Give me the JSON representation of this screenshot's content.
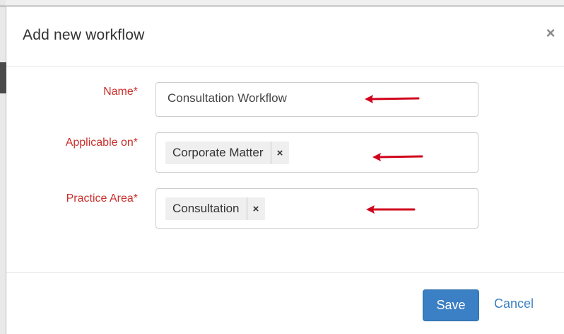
{
  "modal": {
    "title": "Add new workflow",
    "close_symbol": "×"
  },
  "form": {
    "name": {
      "label": "Name*",
      "value": "Consultation Workflow"
    },
    "applicable_on": {
      "label": "Applicable on*",
      "tags": [
        {
          "label": "Corporate Matter",
          "remove_symbol": "×"
        }
      ]
    },
    "practice_area": {
      "label": "Practice Area*",
      "tags": [
        {
          "label": "Consultation",
          "remove_symbol": "×"
        }
      ]
    }
  },
  "footer": {
    "save_label": "Save",
    "cancel_label": "Cancel"
  },
  "annotations": {
    "arrow_color": "#d0021b",
    "arrow_icon": "arrow-left-icon"
  },
  "colors": {
    "label_required": "#c9302c",
    "primary_button": "#3b7fc4",
    "link": "#3b7fc4"
  }
}
